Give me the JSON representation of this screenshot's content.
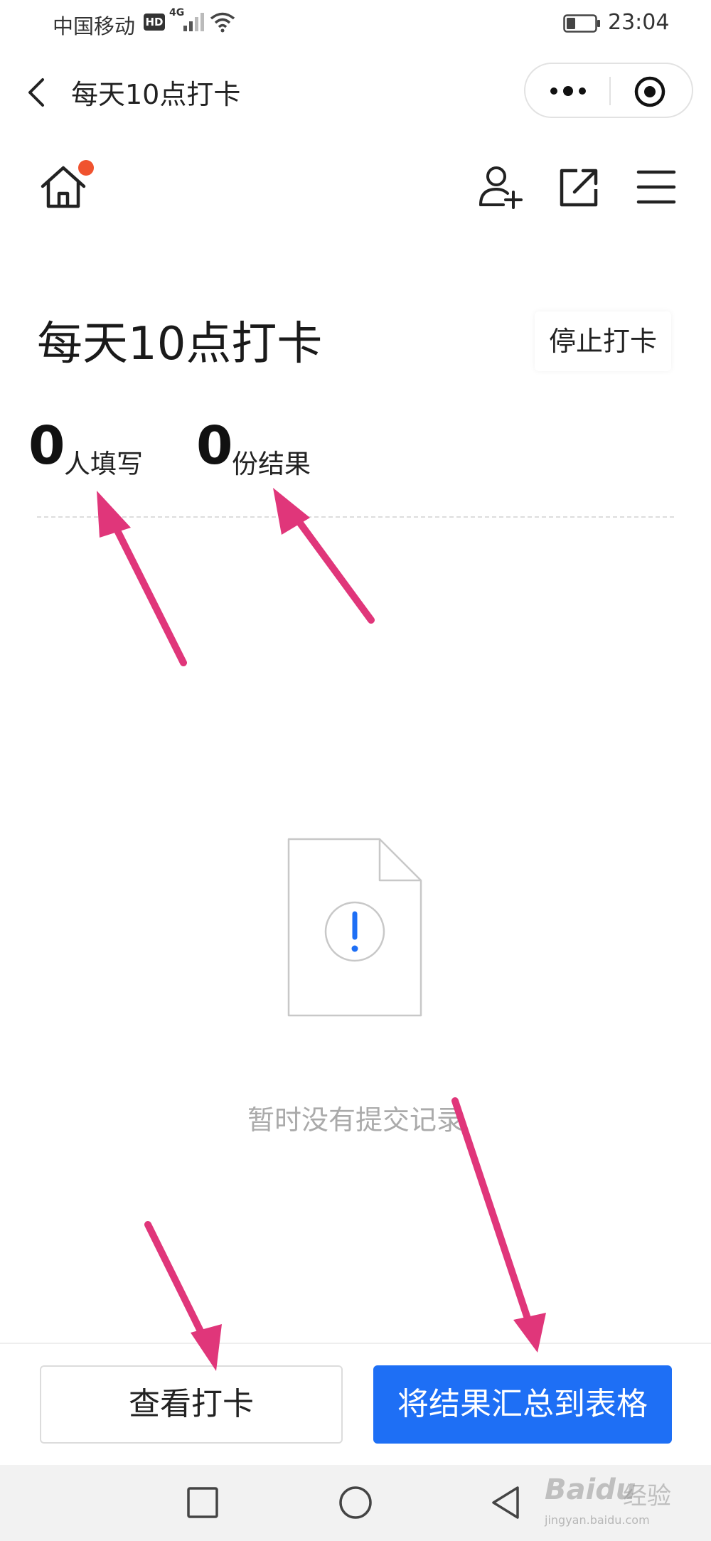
{
  "status_bar": {
    "carrier": "中国移动",
    "hd": "HD",
    "network": "4G",
    "time": "23:04"
  },
  "nav": {
    "title": "每天10点打卡"
  },
  "page": {
    "title": "每天10点打卡",
    "stop_button": "停止打卡",
    "stats": [
      {
        "count": "0",
        "label": "人填写"
      },
      {
        "count": "0",
        "label": "份结果"
      }
    ],
    "empty_text": "暂时没有提交记录"
  },
  "footer": {
    "view_button": "查看打卡",
    "export_button": "将结果汇总到表格"
  },
  "watermark": {
    "brand": "Baidu",
    "suffix": "经验",
    "url": "jingyan.baidu.com"
  },
  "colors": {
    "primary": "#1e6ff5",
    "notify_dot": "#f0532f",
    "arrow": "#e0367a"
  },
  "icons": [
    "back-icon",
    "more-icon",
    "record-icon",
    "home-icon",
    "add-user-icon",
    "share-icon",
    "menu-icon",
    "document-alert-icon"
  ]
}
